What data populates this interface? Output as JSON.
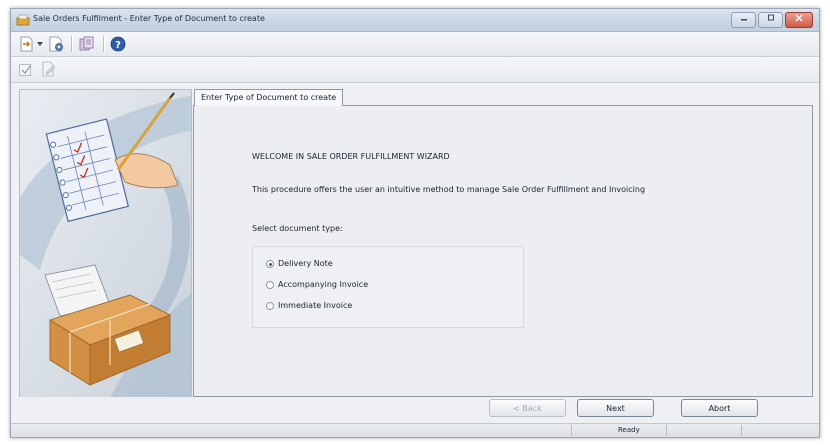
{
  "window": {
    "title": "Sale Orders Fulfilment - Enter Type of Document to create",
    "controls": [
      "minimize",
      "maximize",
      "close"
    ]
  },
  "toolbar": {
    "row1_icons": [
      "new-document-icon",
      "dropdown-arrow-icon",
      "settings-document-icon",
      "database-icon",
      "help-icon"
    ],
    "row2_icons": [
      "checkbox-icon",
      "document-edit-icon"
    ]
  },
  "wizard": {
    "tab_label": "Enter Type of Document to create",
    "welcome": "WELCOME IN SALE ORDER FULFILLMENT WIZARD",
    "description": "This procedure offers the user an intuitive method to manage Sale Order Fulfillment and Invoicing",
    "select_label": "Select document type:",
    "options": [
      {
        "label": "Delivery Note",
        "checked": true
      },
      {
        "label": "Accompanying Invoice",
        "checked": false
      },
      {
        "label": "Immediate Invoice",
        "checked": false
      }
    ]
  },
  "buttons": {
    "back": "< Back",
    "next": "Next",
    "abort": "Abort"
  },
  "status": {
    "text": "Ready"
  },
  "colors": {
    "title_bar": "#c9d6e6",
    "close_button": "#cf5a44",
    "panel_bg": "#eceef1",
    "radio_accent": "#2a5aa8"
  }
}
